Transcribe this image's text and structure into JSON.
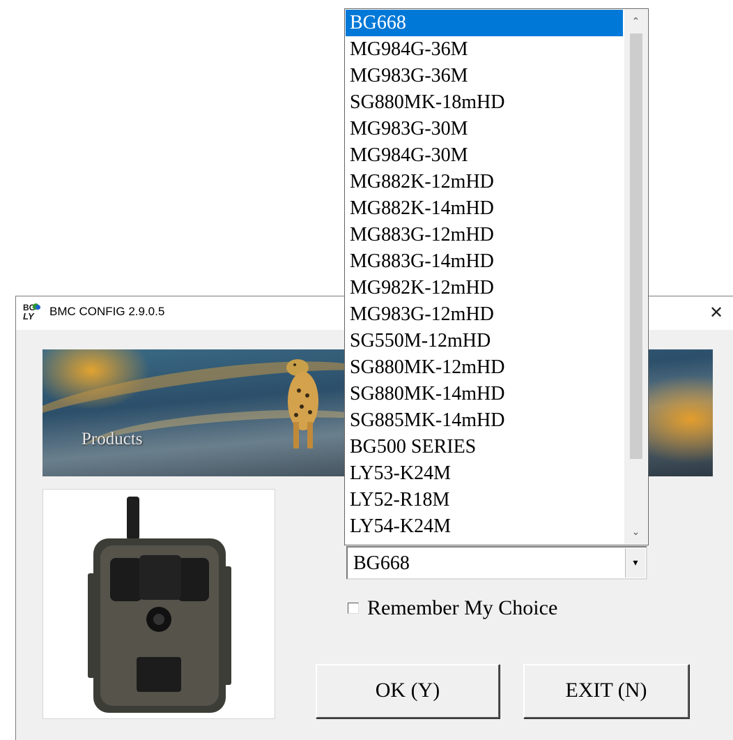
{
  "window": {
    "title": "BMC CONFIG 2.9.0.5",
    "icon_text_top": "BG",
    "icon_text_bottom": "LY",
    "close_glyph": "✕"
  },
  "banner": {
    "label": "Products"
  },
  "model_select": {
    "selected_value": "BG668",
    "arrow_glyph": "▾",
    "options": [
      "BG668",
      "MG984G-36M",
      "MG983G-36M",
      "SG880MK-18mHD",
      "MG983G-30M",
      "MG984G-30M",
      "MG882K-12mHD",
      "MG882K-14mHD",
      "MG883G-12mHD",
      "MG883G-14mHD",
      "MG982K-12mHD",
      "MG983G-12mHD",
      "SG550M-12mHD",
      "SG880MK-12mHD",
      "SG880MK-14mHD",
      "SG885MK-14mHD",
      "BG500 SERIES",
      "LY53-K24M",
      "LY52-R18M",
      "LY54-K24M"
    ],
    "scroll_up_glyph": "⌃",
    "scroll_down_glyph": "⌄"
  },
  "remember_checkbox": {
    "label": "Remember My Choice",
    "checked": false
  },
  "buttons": {
    "ok_label": "OK (Y)",
    "exit_label": "EXIT (N)"
  },
  "colors": {
    "selection": "#0078d7",
    "window_bg": "#f0f0f0"
  }
}
